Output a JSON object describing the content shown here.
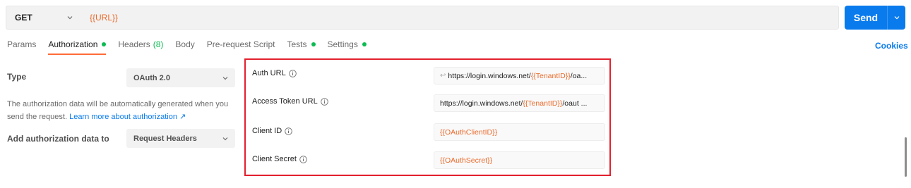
{
  "request": {
    "method": "GET",
    "url": "{{URL}}",
    "send_label": "Send"
  },
  "tabs": [
    {
      "label": "Params",
      "active": false,
      "indicator": null
    },
    {
      "label": "Authorization",
      "active": true,
      "indicator": "dot"
    },
    {
      "label": "Headers",
      "count": "(8)",
      "active": false
    },
    {
      "label": "Body",
      "active": false
    },
    {
      "label": "Pre-request Script",
      "active": false
    },
    {
      "label": "Tests",
      "active": false,
      "indicator": "dot"
    },
    {
      "label": "Settings",
      "active": false,
      "indicator": "dot"
    }
  ],
  "cookies_label": "Cookies",
  "auth": {
    "type_label": "Type",
    "type_value": "OAuth 2.0",
    "description_text": "The authorization data will be automatically generated when you send the request.",
    "description_link": "Learn more about authorization ↗",
    "add_to_label": "Add authorization data to",
    "add_to_value": "Request Headers"
  },
  "fields": {
    "auth_url": {
      "label": "Auth URL",
      "value_prefix": "https://login.windows.net/",
      "value_var": "{{TenantID}}",
      "value_suffix": "/oa..."
    },
    "access_token_url": {
      "label": "Access Token URL",
      "value_prefix": "https://login.windows.net/",
      "value_var": "{{TenantID}}",
      "value_suffix": "/oaut ..."
    },
    "client_id": {
      "label": "Client ID",
      "value_var": "{{OAuthClientID}}"
    },
    "client_secret": {
      "label": "Client Secret",
      "value_var": "{{OAuthSecret}}"
    }
  },
  "colors": {
    "accent_orange": "#ff6c37",
    "variable_orange": "#ea6a2b",
    "send_blue": "#097bed",
    "status_green": "#0cbb52",
    "highlight_red": "#e3202e"
  },
  "icons": {
    "method_dropdown": "chevron-down-icon",
    "send_dropdown": "chevron-down-icon",
    "field_info": "info-icon",
    "auth_url_arrow": "return-arrow-icon"
  }
}
